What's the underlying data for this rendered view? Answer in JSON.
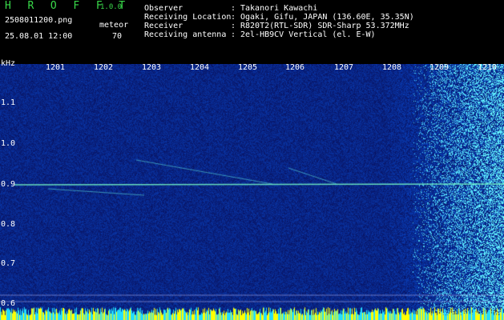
{
  "brand": {
    "name": "H R O F F T",
    "version": "1.0.0"
  },
  "file": {
    "name": "2508011200.png",
    "datetime": "25.08.01 12:00"
  },
  "meteor": {
    "label": "meteor",
    "count": "70"
  },
  "info": [
    {
      "key": "Observer",
      "value": "Takanori Kawachi"
    },
    {
      "key": "Receiving Location",
      "value": "Ogaki, Gifu, JAPAN (136.60E, 35.35N)"
    },
    {
      "key": "Receiver",
      "value": "R820T2(RTL-SDR) SDR-Sharp 53.372MHz"
    },
    {
      "key": "Receiving antenna",
      "value": "2el-HB9CV Vertical (el. E-W)"
    }
  ],
  "axis": {
    "unit": "kHz",
    "y_ticks": [
      "1.1",
      "1.0",
      "0.9",
      "0.8",
      "0.7",
      "0.6"
    ],
    "x_ticks": [
      "1201",
      "1202",
      "1203",
      "1204",
      "1205",
      "1206",
      "1207",
      "1208",
      "1209",
      "1210"
    ]
  },
  "colors": {
    "brand": "#39d94a",
    "background": "#1a2a9a",
    "text": "#ffffff"
  }
}
